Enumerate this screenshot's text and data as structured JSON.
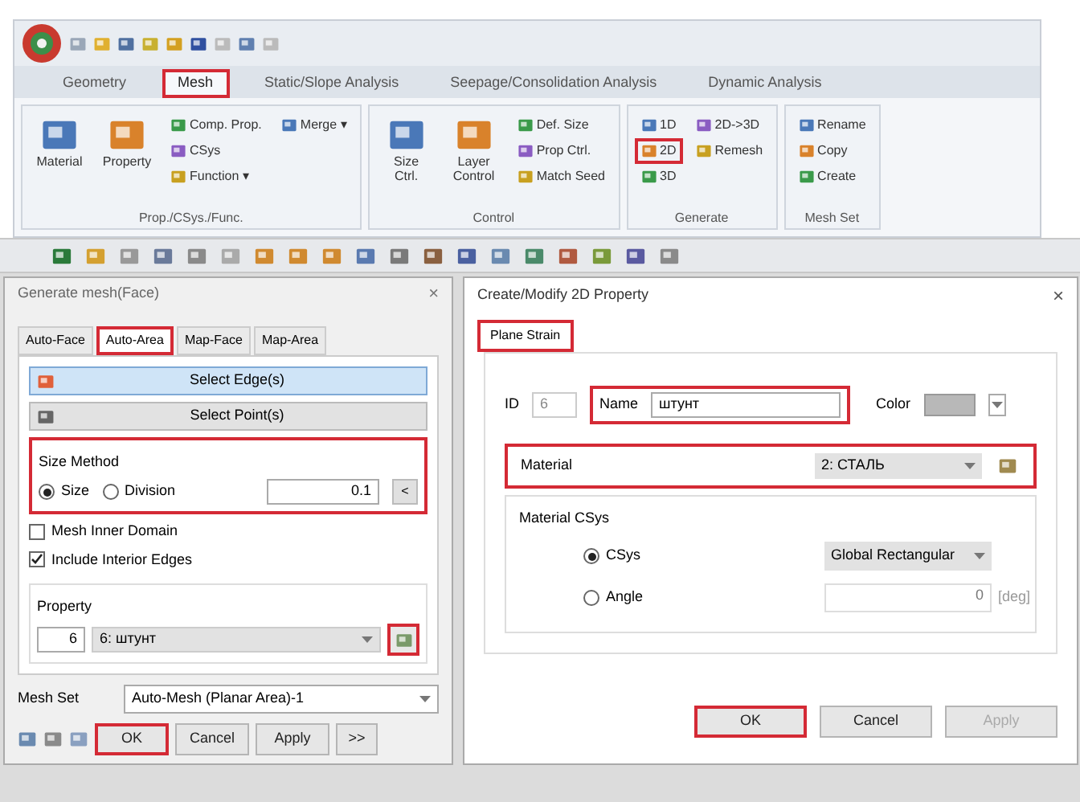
{
  "ribbon": {
    "tabs": [
      {
        "label": "Geometry",
        "selected": false,
        "highlighted": false
      },
      {
        "label": "Mesh",
        "selected": true,
        "highlighted": true
      },
      {
        "label": "Static/Slope Analysis",
        "selected": false,
        "highlighted": false
      },
      {
        "label": "Seepage/Consolidation Analysis",
        "selected": false,
        "highlighted": false
      },
      {
        "label": "Dynamic Analysis",
        "selected": false,
        "highlighted": false
      }
    ],
    "groups": [
      {
        "title": "Prop./CSys./Func.",
        "items": [
          {
            "kind": "large",
            "label": "Material",
            "highlighted": false
          },
          {
            "kind": "large",
            "label": "Property",
            "highlighted": false
          },
          {
            "kind": "small",
            "label": "Comp. Prop.",
            "highlighted": false
          },
          {
            "kind": "small",
            "label": "CSys",
            "highlighted": false
          },
          {
            "kind": "small",
            "label": "Function ▾",
            "highlighted": false
          },
          {
            "kind": "small",
            "label": "Merge ▾",
            "highlighted": false
          }
        ]
      },
      {
        "title": "Control",
        "items": [
          {
            "kind": "large",
            "label": "Size Ctrl.",
            "highlighted": false
          },
          {
            "kind": "large",
            "label": "Layer Control",
            "highlighted": false
          },
          {
            "kind": "small",
            "label": "Def. Size",
            "highlighted": false
          },
          {
            "kind": "small",
            "label": "Prop Ctrl.",
            "highlighted": false
          },
          {
            "kind": "small",
            "label": "Match Seed",
            "highlighted": false
          }
        ]
      },
      {
        "title": "Generate",
        "items": [
          {
            "kind": "small",
            "label": "1D",
            "highlighted": false
          },
          {
            "kind": "small",
            "label": "2D",
            "highlighted": true
          },
          {
            "kind": "small",
            "label": "3D",
            "highlighted": false
          },
          {
            "kind": "small",
            "label": "2D->3D",
            "highlighted": false
          },
          {
            "kind": "small",
            "label": "Remesh",
            "highlighted": false
          }
        ]
      },
      {
        "title": "Mesh Set",
        "items": [
          {
            "kind": "small",
            "label": "Rename",
            "highlighted": false
          },
          {
            "kind": "small",
            "label": "Copy",
            "highlighted": false
          },
          {
            "kind": "small",
            "label": "Create",
            "highlighted": false
          }
        ]
      }
    ]
  },
  "mesh_dialog": {
    "title": "Generate mesh(Face)",
    "close": "×",
    "tabs": [
      {
        "label": "Auto-Face",
        "selected": false,
        "highlighted": false
      },
      {
        "label": "Auto-Area",
        "selected": true,
        "highlighted": true
      },
      {
        "label": "Map-Face",
        "selected": false,
        "highlighted": false
      },
      {
        "label": "Map-Area",
        "selected": false,
        "highlighted": false
      }
    ],
    "selectors": [
      {
        "label": "Select Edge(s)",
        "selected": true
      },
      {
        "label": "Select Point(s)",
        "selected": false
      }
    ],
    "size_method": {
      "title": "Size Method",
      "highlighted": true,
      "options": [
        {
          "label": "Size",
          "selected": true
        },
        {
          "label": "Division",
          "selected": false
        }
      ],
      "value": "0.1",
      "pick": "<"
    },
    "checks": [
      {
        "label": "Mesh Inner Domain",
        "checked": false
      },
      {
        "label": "Include Interior Edges",
        "checked": true
      }
    ],
    "property": {
      "title": "Property",
      "id": "6",
      "value": "6: штунт",
      "button_highlighted": true
    },
    "mesh_set": {
      "label": "Mesh Set",
      "value": "Auto-Mesh (Planar Area)-1"
    },
    "buttons": [
      {
        "label": "OK",
        "highlighted": true
      },
      {
        "label": "Cancel",
        "highlighted": false
      },
      {
        "label": "Apply",
        "highlighted": false
      },
      {
        "label": ">>",
        "highlighted": false
      }
    ]
  },
  "property_dialog": {
    "title": "Create/Modify 2D Property",
    "close": "×",
    "tabs": [
      {
        "label": "Plane Strain",
        "selected": true,
        "highlighted": true
      }
    ],
    "id": {
      "label": "ID",
      "value": "6"
    },
    "name": {
      "label": "Name",
      "value": "штунт",
      "highlighted": true
    },
    "color": {
      "label": "Color"
    },
    "material": {
      "label": "Material",
      "value": "2: СТАЛЬ",
      "highlighted": true
    },
    "csys": {
      "title": "Material CSys",
      "options": [
        {
          "label": "CSys",
          "selected": true
        },
        {
          "label": "Angle",
          "selected": false
        }
      ],
      "value": "Global Rectangular",
      "angle": "0",
      "unit": "[deg]"
    },
    "buttons": [
      {
        "label": "OK",
        "highlighted": true,
        "disabled": false
      },
      {
        "label": "Cancel",
        "highlighted": false,
        "disabled": false
      },
      {
        "label": "Apply",
        "highlighted": false,
        "disabled": true
      }
    ]
  }
}
